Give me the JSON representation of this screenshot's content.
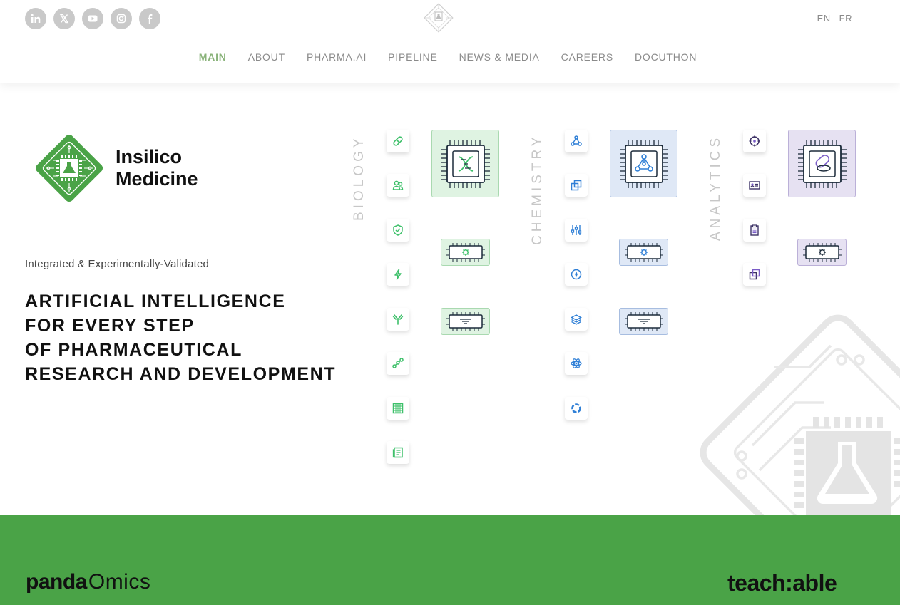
{
  "header": {
    "socials": [
      {
        "name": "linkedin-icon",
        "label": "in"
      },
      {
        "name": "x-icon",
        "label": "𝕏"
      },
      {
        "name": "youtube-icon",
        "label": "▶"
      },
      {
        "name": "instagram-icon",
        "label": "◎"
      },
      {
        "name": "facebook-icon",
        "label": "f"
      }
    ],
    "languages": [
      "EN",
      "FR"
    ],
    "nav": [
      {
        "label": "MAIN",
        "active": true
      },
      {
        "label": "ABOUT",
        "active": false
      },
      {
        "label": "PHARMA.AI",
        "active": false
      },
      {
        "label": "PIPELINE",
        "active": false
      },
      {
        "label": "NEWS & MEDIA",
        "active": false
      },
      {
        "label": "CAREERS",
        "active": false
      },
      {
        "label": "DOCUTHON",
        "active": false
      }
    ]
  },
  "hero": {
    "brand_line1": "Insilico",
    "brand_line2": "Medicine",
    "subtitle": "Integrated & Experimentally-Validated",
    "headline": [
      "ARTIFICIAL INTELLIGENCE",
      "FOR EVERY STEP",
      "OF PHARMACEUTICAL",
      "RESEARCH AND DEVELOPMENT"
    ]
  },
  "columns": [
    {
      "label": "BIOLOGY",
      "color": "#3ec06a",
      "chip_bg": "#dff3e2",
      "chip_border": "#a9d9b0",
      "main_icon": "dna-icon",
      "tiles": [
        "pill-icon",
        "people-icon",
        "shield-icon",
        "lightning-icon",
        "antibody-icon",
        "graph-icon",
        "grid-icon",
        "document-icon"
      ]
    },
    {
      "label": "CHEMISTRY",
      "color": "#2f7fd6",
      "chip_bg": "#dfe8f6",
      "chip_border": "#a7bde0",
      "main_icon": "molecule-icon",
      "tiles": [
        "molecule-icon",
        "layers-copy-icon",
        "sliders-icon",
        "compass-icon",
        "stack-icon",
        "atom-icon",
        "ring-icon"
      ]
    },
    {
      "label": "ANALYTICS",
      "color": "#7a5cc7",
      "chip_bg": "#e6e1f2",
      "chip_border": "#bbb0d8",
      "main_icon": "capsule-icon",
      "tiles": [
        "target-icon",
        "id-card-icon",
        "clipboard-icon",
        "copy-icon"
      ]
    }
  ],
  "footer": {
    "panda_bold": "panda",
    "panda_light": "Omics",
    "teach": "teach:able",
    "band_color": "#4aa347"
  }
}
